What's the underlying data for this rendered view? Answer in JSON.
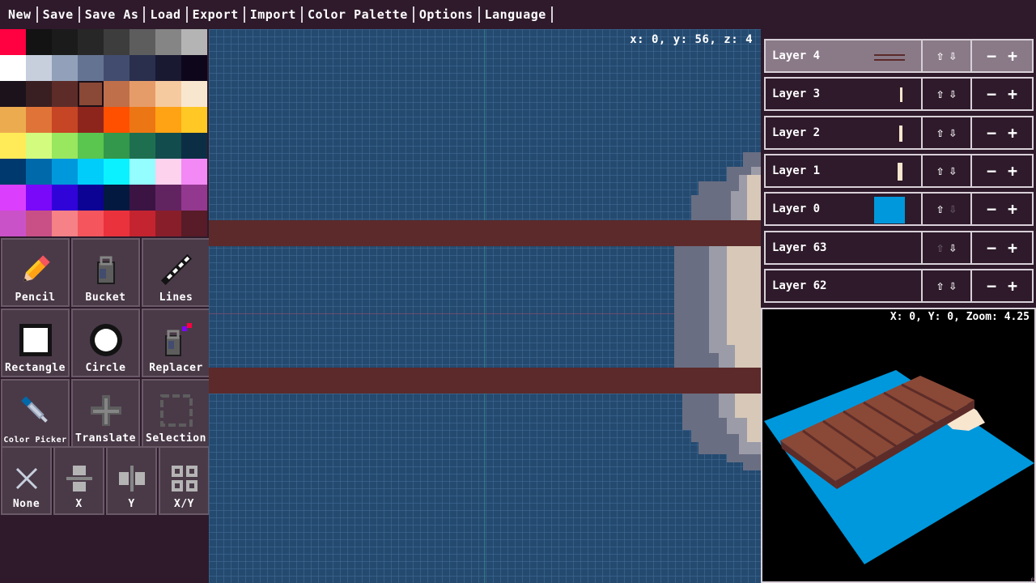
{
  "menu": [
    "New",
    "Save",
    "Save As",
    "Load",
    "Export",
    "Import",
    "Color Palette",
    "Options",
    "Language"
  ],
  "palette": {
    "selected_index": 19,
    "colors": [
      "#ff0040",
      "#131313",
      "#1b1b1b",
      "#272727",
      "#3d3d3d",
      "#5d5d5d",
      "#858585",
      "#b4b4b4",
      "#ffffff",
      "#c7cfdd",
      "#92a1b9",
      "#657392",
      "#424c6e",
      "#2a2f4e",
      "#1a1932",
      "#0e071b",
      "#1c121c",
      "#391f21",
      "#5d2c28",
      "#8a4836",
      "#bf6f4a",
      "#e69c69",
      "#f6ca9f",
      "#f9e6cf",
      "#edab50",
      "#e07438",
      "#c64524",
      "#8e251d",
      "#ff5000",
      "#ed7614",
      "#ffa214",
      "#ffc825",
      "#ffeb57",
      "#d3fc7e",
      "#99e65f",
      "#5ac54f",
      "#33984b",
      "#1e6f50",
      "#134c4c",
      "#0c2e44",
      "#00396d",
      "#0069aa",
      "#0098dc",
      "#00cdf9",
      "#0cf1ff",
      "#94fdff",
      "#fdd2ed",
      "#f389f5",
      "#db3ffd",
      "#7a09fa",
      "#3003d9",
      "#0c0293",
      "#03193f",
      "#3b1443",
      "#622461",
      "#93388f",
      "#ca52c9",
      "#c85086",
      "#f68187",
      "#f5555d",
      "#ea323c",
      "#c42430",
      "#891e2b",
      "#571c27"
    ]
  },
  "tools": [
    {
      "label": "Pencil",
      "icon": "pencil-icon"
    },
    {
      "label": "Bucket",
      "icon": "bucket-icon"
    },
    {
      "label": "Lines",
      "icon": "lines-icon"
    },
    {
      "label": "Rectangle",
      "icon": "rectangle-icon"
    },
    {
      "label": "Circle",
      "icon": "circle-icon"
    },
    {
      "label": "Replacer",
      "icon": "replacer-icon"
    },
    {
      "label": "Color Picker",
      "icon": "color-picker-icon"
    },
    {
      "label": "Translate",
      "icon": "translate-icon"
    },
    {
      "label": "Selection",
      "icon": "selection-icon"
    }
  ],
  "mirror": [
    {
      "label": "None",
      "icon": "mirror-none-icon"
    },
    {
      "label": "X",
      "icon": "mirror-x-icon"
    },
    {
      "label": "Y",
      "icon": "mirror-y-icon"
    },
    {
      "label": "X/Y",
      "icon": "mirror-xy-icon"
    }
  ],
  "canvas": {
    "coords": "x: 0, y: 56, z: 4"
  },
  "layers": [
    {
      "name": "Layer 4",
      "active": true,
      "up_enabled": true,
      "down_enabled": true
    },
    {
      "name": "Layer 3",
      "active": false,
      "up_enabled": true,
      "down_enabled": true
    },
    {
      "name": "Layer 2",
      "active": false,
      "up_enabled": true,
      "down_enabled": true
    },
    {
      "name": "Layer 1",
      "active": false,
      "up_enabled": true,
      "down_enabled": true
    },
    {
      "name": "Layer 0",
      "active": false,
      "up_enabled": true,
      "down_enabled": false
    },
    {
      "name": "Layer 63",
      "active": false,
      "up_enabled": false,
      "down_enabled": true
    },
    {
      "name": "Layer 62",
      "active": false,
      "up_enabled": true,
      "down_enabled": true
    }
  ],
  "preview": {
    "coords": "X: 0, Y: 0, Zoom: 4.25"
  },
  "colors": {
    "background": "#2e1a2b",
    "canvas": "#244a70",
    "plank": "#5c2a2a",
    "water": "#0098dc",
    "wood": "#8a4836"
  }
}
